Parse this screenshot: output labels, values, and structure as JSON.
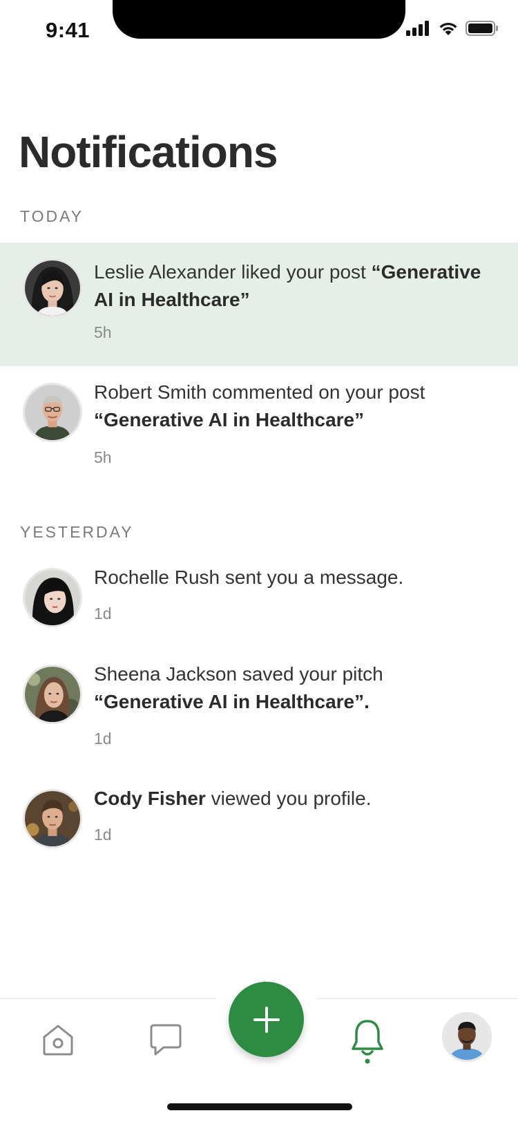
{
  "status_bar": {
    "time": "9:41"
  },
  "page": {
    "title": "Notifications"
  },
  "sections": {
    "today": "TODAY",
    "yesterday": "YESTERDAY"
  },
  "notifications": [
    {
      "name": "Leslie Alexander",
      "action": " liked your post ",
      "target": "“Generative AI in Healthcare”",
      "time": "5h",
      "avatar": "avatar-leslie",
      "highlighted": true
    },
    {
      "name": "Robert Smith",
      "action": " commented on your post",
      "target": "“Generative AI in Healthcare”",
      "time": "5h",
      "avatar": "avatar-robert"
    },
    {
      "name": "Rochelle Rush",
      "action": " sent you a message.",
      "time": "1d",
      "avatar": "avatar-rochelle"
    },
    {
      "name": "Sheena Jackson",
      "action": " saved your pitch",
      "target": "“Generative AI in Healthcare”.",
      "time": "1d",
      "avatar": "avatar-sheena"
    },
    {
      "name": "Cody Fisher",
      "action": " viewed you profile.",
      "time": "1d",
      "avatar": "avatar-cody"
    }
  ],
  "nav": {
    "items": [
      "home-icon",
      "chat-icon",
      "add-icon",
      "bell-icon",
      "profile-avatar"
    ],
    "active": "bell-icon"
  },
  "colors": {
    "accent": "#2e8b43",
    "highlight_bg": "#e5efe7"
  }
}
